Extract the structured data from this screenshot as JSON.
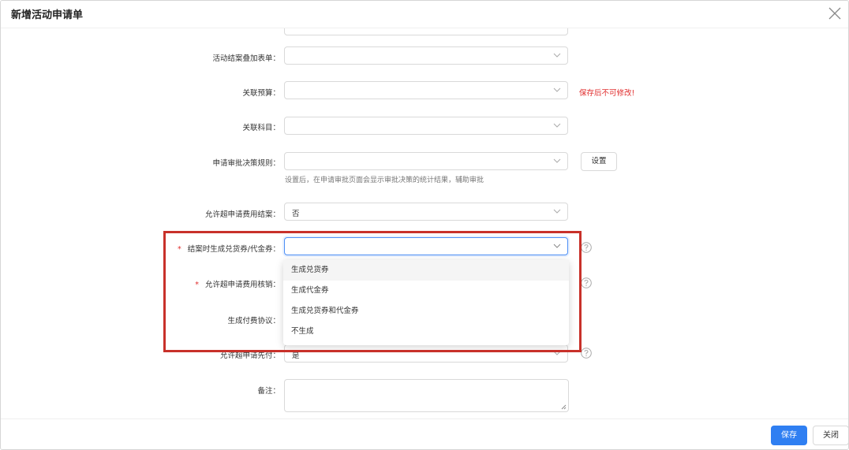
{
  "dialog": {
    "title": "新增活动申请单"
  },
  "form": {
    "settle_overlay_form": {
      "label": "活动结案叠加表单：",
      "value": ""
    },
    "related_budget": {
      "label": "关联预算：",
      "value": "",
      "warning": "保存后不可修改!"
    },
    "related_subject": {
      "label": "关联科目：",
      "value": ""
    },
    "approval_rule": {
      "label": "申请审批决策规则：",
      "value": "",
      "button": "设置",
      "hint": "设置后，在申请审批页面会显示审批决策的统计结果，辅助审批"
    },
    "allow_over_settle": {
      "label": "允许超申请费用结案：",
      "value": "否"
    },
    "gen_voucher": {
      "required_mark": "*",
      "label": "结案时生成兑货券/代金券：",
      "value": ""
    },
    "allow_over_writeoff": {
      "required_mark": "*",
      "label": "允许超申请费用核销：",
      "value": ""
    },
    "gen_payment": {
      "label": "生成付费协议：",
      "value": ""
    },
    "allow_over_prepay": {
      "label": "允许超申请先付：",
      "value": "是"
    },
    "remark": {
      "label": "备注：",
      "value": ""
    }
  },
  "dropdown": {
    "options": [
      "生成兑货券",
      "生成代金券",
      "生成兑货券和代金券",
      "不生成"
    ],
    "highlighted": 0
  },
  "footer": {
    "save": "保存",
    "close": "关闭"
  },
  "colors": {
    "primary": "#2f7ff2",
    "danger": "#e02d2d",
    "highlight_box": "#c8312a"
  },
  "icons": {
    "close": "close-icon",
    "chevron": "chevron-down-icon",
    "help": "question-circle-icon",
    "resize": "resize-grip-icon"
  }
}
